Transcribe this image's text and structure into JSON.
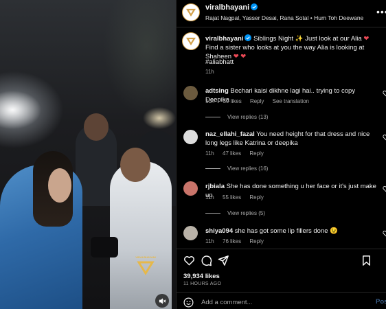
{
  "colors": {
    "background": "#000000",
    "text": "#f5f5f5",
    "muted": "#a8a8a8",
    "heart": "#ed4956",
    "verified": "#0095f6",
    "avatar_ring": "#d4a14a"
  },
  "media": {
    "mute_icon": "speaker-muted-icon",
    "watermark_icon": "viral-bhayani-watermark"
  },
  "header": {
    "username": "viralbhayani",
    "tagged": "Rajat Nagpal, Yasser Desai, Rana Sotal",
    "separator": "•",
    "audio": "Hum Toh Deewane",
    "more_icon": "more-horizontal-icon"
  },
  "caption": {
    "username": "viralbhayani",
    "text_a": "Siblings Night ✨ Just look at our Alia",
    "text_b": "Find a sister who looks at you the way Alia is looking at Shaheen",
    "hashtag": "#aliabhatt",
    "time": "11h"
  },
  "comments": [
    {
      "username": "adtsing",
      "text": "Bechari kaisi dikhne lagi hai.. trying to copy Deepika",
      "time": "10h",
      "likes": "39 likes",
      "reply": "Reply",
      "extra": "See translation",
      "view_replies": "View replies (13)",
      "avatar_color": "#6b5a3e"
    },
    {
      "username": "naz_ellahi_fazal",
      "text": "You need height for that dress and nice long legs like Katrina or deepika",
      "time": "11h",
      "likes": "47 likes",
      "reply": "Reply",
      "extra": "",
      "view_replies": "View replies (16)",
      "avatar_color": "#dcdcdc"
    },
    {
      "username": "rjbiala",
      "text": "She has done something u her face or it's just make up",
      "time": "11h",
      "likes": "55 likes",
      "reply": "Reply",
      "extra": "",
      "view_replies": "View replies (5)",
      "avatar_color": "#c9746a"
    },
    {
      "username": "shiya094",
      "text": "she has got some lip fillers done 😉",
      "time": "11h",
      "likes": "76 likes",
      "reply": "Reply",
      "extra": "",
      "view_replies": "",
      "avatar_color": "#b9b2a8"
    }
  ],
  "actions": {
    "like_icon": "heart-icon",
    "comment_icon": "comment-icon",
    "share_icon": "share-icon",
    "save_icon": "bookmark-icon"
  },
  "likes_count": "39,934 likes",
  "time_ago": "11 HOURS AGO",
  "add_comment": {
    "placeholder": "Add a comment...",
    "post_label": "Post",
    "emoji_icon": "emoji-icon"
  }
}
